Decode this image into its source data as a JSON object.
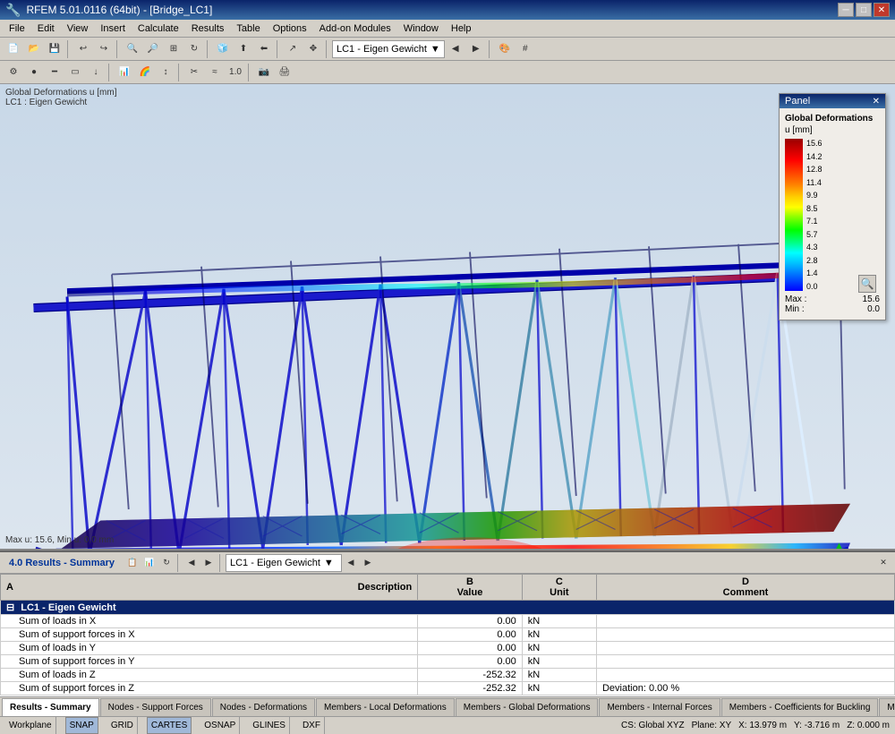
{
  "titlebar": {
    "title": "RFEM 5.01.0116 (64bit) - [Bridge_LC1]",
    "buttons": [
      "minimize",
      "maximize",
      "close"
    ]
  },
  "menubar": {
    "items": [
      "File",
      "Edit",
      "View",
      "Insert",
      "Calculate",
      "Results",
      "Table",
      "Options",
      "Add-on Modules",
      "Window",
      "Help"
    ]
  },
  "toolbar1": {
    "dropdown_lc": "LC1 - Eigen Gewicht"
  },
  "viewport": {
    "info_top_line1": "Global Deformations u [mm]",
    "info_top_line2": "LC1 : Eigen Gewicht",
    "info_bottom": "Max u: 15.6, Min u: 0.0 mm"
  },
  "legend_panel": {
    "title": "Panel",
    "subtitle": "Global Deformations",
    "unit": "u [mm]",
    "values": [
      "15.6",
      "14.2",
      "12.8",
      "11.4",
      "9.9",
      "8.5",
      "7.1",
      "5.7",
      "4.3",
      "2.8",
      "1.4",
      "0.0"
    ],
    "max_label": "Max :",
    "max_value": "15.6",
    "min_label": "Min :",
    "min_value": "0.0"
  },
  "results_panel": {
    "title": "4.0 Results - Summary",
    "columns": {
      "A": "Description",
      "B": "Value",
      "C": "Unit",
      "D": "Comment"
    },
    "lc_header": "LC1 - Eigen Gewicht",
    "rows": [
      {
        "desc": "Sum of loads in X",
        "value": "0.00",
        "unit": "kN",
        "comment": ""
      },
      {
        "desc": "Sum of support forces in X",
        "value": "0.00",
        "unit": "kN",
        "comment": ""
      },
      {
        "desc": "Sum of loads in Y",
        "value": "0.00",
        "unit": "kN",
        "comment": ""
      },
      {
        "desc": "Sum of support forces in Y",
        "value": "0.00",
        "unit": "kN",
        "comment": ""
      },
      {
        "desc": "Sum of loads in Z",
        "value": "-252.32",
        "unit": "kN",
        "comment": ""
      },
      {
        "desc": "Sum of support forces in Z",
        "value": "-252.32",
        "unit": "kN",
        "comment": "Deviation: 0.00 %"
      }
    ]
  },
  "tabs": [
    {
      "label": "Results - Summary",
      "active": true
    },
    {
      "label": "Nodes - Support Forces",
      "active": false
    },
    {
      "label": "Nodes - Deformations",
      "active": false
    },
    {
      "label": "Members - Local Deformations",
      "active": false
    },
    {
      "label": "Members - Global Deformations",
      "active": false
    },
    {
      "label": "Members - Internal Forces",
      "active": false
    },
    {
      "label": "Members - Coefficients for Buckling",
      "active": false
    },
    {
      "label": "Member Slendernesses",
      "active": false
    }
  ],
  "statusbar": {
    "left": "Workplane",
    "items": [
      "SNAP",
      "GRID",
      "CARTES",
      "OSNAP",
      "GLINES",
      "DXF"
    ],
    "cs": "CS: Global XYZ",
    "plane": "Plane: XY",
    "x_coord": "X: 13.979 m",
    "y_coord": "Y: -3.716 m",
    "z_coord": "Z: 0.000 m"
  }
}
